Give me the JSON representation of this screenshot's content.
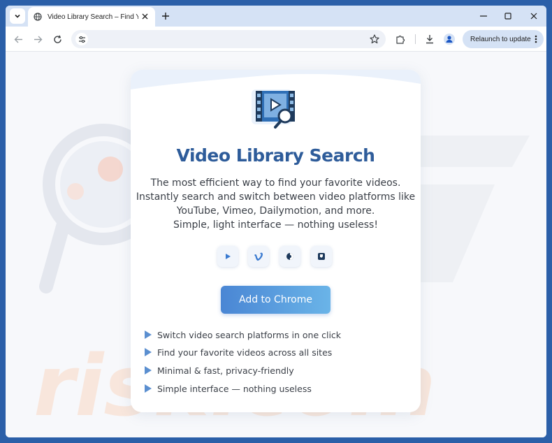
{
  "browser": {
    "tab_title": "Video Library Search – Find You",
    "new_tab_label": "+",
    "relaunch_label": "Relaunch to update"
  },
  "page": {
    "title": "Video Library Search",
    "description_lines": [
      "The most efficient way to find your favorite videos.",
      "Instantly search and switch between video platforms like",
      "YouTube, Vimeo, Dailymotion, and more.",
      "Simple, light interface — nothing useless!"
    ],
    "platform_icons": [
      "youtube-icon",
      "vimeo-icon",
      "dailymotion-icon",
      "video-platform-icon"
    ],
    "cta_label": "Add to Chrome",
    "features": [
      "Switch video search platforms in one click",
      "Find your favorite videos across all sites",
      "Minimal & fast, privacy-friendly",
      "Simple interface — nothing useless"
    ]
  },
  "colors": {
    "title": "#2e5c9a",
    "cta_start": "#4a86d4",
    "cta_end": "#6ab4e8",
    "bullet": "#5b8fd0"
  }
}
